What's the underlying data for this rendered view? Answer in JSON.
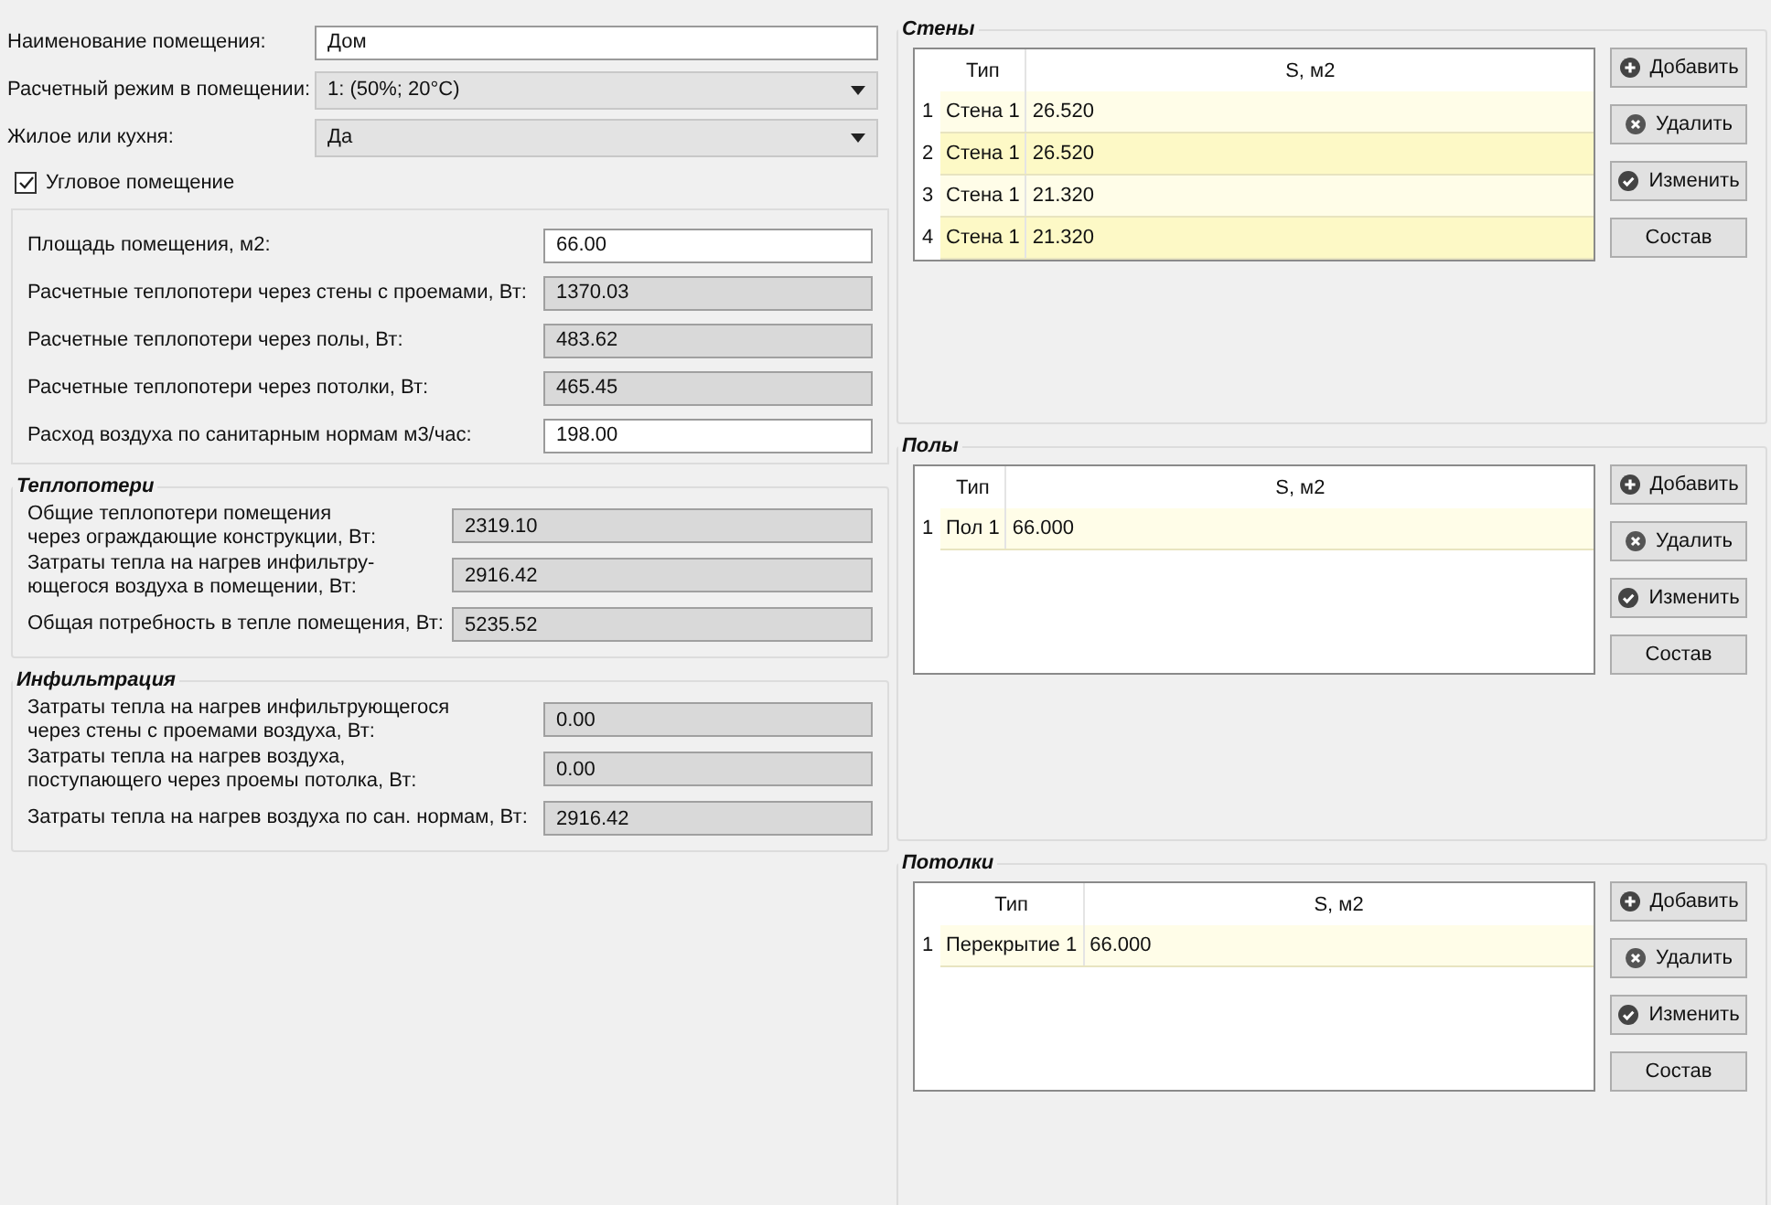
{
  "room_fields": [
    {
      "kind": "text",
      "label": "Наименование помещения:",
      "value": "Дом"
    },
    {
      "kind": "select",
      "label": "Расчетный режим в помещении:",
      "value": "1: (50%; 20°C)"
    },
    {
      "kind": "select",
      "label": "Жилое или кухня:",
      "value": "Да"
    }
  ],
  "corner_room": {
    "label": "Угловое помещение",
    "checked": true
  },
  "area_panel": [
    {
      "label": "Площадь помещения, м2:",
      "value": "66.00",
      "readonly": false
    },
    {
      "label": "Расчетные теплопотери через стены с проемами, Вт:",
      "value": "1370.03",
      "readonly": true
    },
    {
      "label": "Расчетные теплопотери через полы, Вт:",
      "value": "483.62",
      "readonly": true
    },
    {
      "label": "Расчетные теплопотери через потолки, Вт:",
      "value": "465.45",
      "readonly": true
    },
    {
      "label": "Расход воздуха по санитарным нормам м3/час:",
      "value": "198.00",
      "readonly": false
    }
  ],
  "result_groups": [
    {
      "title": "Теплопотери",
      "rows": [
        {
          "label": "Общие теплопотери помещения\nчерез ограждающие конструкции, Вт:",
          "value": "2319.10",
          "readonly": true
        },
        {
          "label": "Затраты тепла на нагрев инфильтру-\nющегося воздуха в помещении, Вт:",
          "value": "2916.42",
          "readonly": true
        },
        {
          "label": "Общая потребность в тепле помещения, Вт:",
          "value": "5235.52",
          "readonly": true
        }
      ]
    },
    {
      "title": "Инфильтрация",
      "rows": [
        {
          "label": "Затраты тепла на нагрев инфильтрующегося\nчерез стены с проемами воздуха, Вт:",
          "value": "0.00",
          "readonly": true
        },
        {
          "label": "Затраты тепла на нагрев воздуха,\nпоступающего через проемы потолка, Вт:",
          "value": "0.00",
          "readonly": true
        },
        {
          "label": "Затраты тепла на нагрев воздуха по сан. нормам, Вт:",
          "value": "2916.42",
          "readonly": true
        }
      ]
    }
  ],
  "surface_groups": [
    {
      "title": "Стены",
      "columns": [
        "Тип",
        "S, м2"
      ],
      "rows": [
        {
          "number": "1",
          "type": "Стена 1",
          "area": "26.520"
        },
        {
          "number": "2",
          "type": "Стена 1",
          "area": "26.520"
        },
        {
          "number": "3",
          "type": "Стена 1",
          "area": "21.320"
        },
        {
          "number": "4",
          "type": "Стена 1",
          "area": "21.320"
        }
      ],
      "buttons": [
        {
          "kind": "add",
          "label": "Добавить"
        },
        {
          "kind": "delete",
          "label": "Удалить"
        },
        {
          "kind": "edit",
          "label": "Изменить"
        },
        {
          "kind": "plain",
          "label": "Состав"
        }
      ]
    },
    {
      "title": "Полы",
      "columns": [
        "Тип",
        "S, м2"
      ],
      "rows": [
        {
          "number": "1",
          "type": "Пол 1",
          "area": "66.000"
        }
      ],
      "buttons": [
        {
          "kind": "add",
          "label": "Добавить"
        },
        {
          "kind": "delete",
          "label": "Удалить"
        },
        {
          "kind": "edit",
          "label": "Изменить"
        },
        {
          "kind": "plain",
          "label": "Состав"
        }
      ]
    },
    {
      "title": "Потолки",
      "columns": [
        "Тип",
        "S, м2"
      ],
      "rows": [
        {
          "number": "1",
          "type": "Перекрытие 1",
          "area": "66.000"
        }
      ],
      "buttons": [
        {
          "kind": "add",
          "label": "Добавить"
        },
        {
          "kind": "delete",
          "label": "Удалить"
        },
        {
          "kind": "edit",
          "label": "Изменить"
        },
        {
          "kind": "plain",
          "label": "Состав"
        }
      ]
    }
  ]
}
